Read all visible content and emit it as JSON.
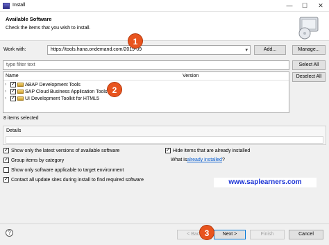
{
  "window": {
    "title": "Install",
    "minimize_glyph": "—",
    "maximize_glyph": "☐",
    "close_glyph": "✕"
  },
  "header": {
    "title": "Available Software",
    "subtitle": "Check the items that you wish to install."
  },
  "work_with": {
    "label": "Work with:",
    "value": "https://tools.hana.ondemand.com/2019-09",
    "add_label": "Add...",
    "manage_label": "Manage..."
  },
  "filter": {
    "placeholder": "type filter text",
    "select_all_label": "Select All",
    "deselect_all_label": "Deselect All"
  },
  "tree": {
    "columns": [
      "Name",
      "Version"
    ],
    "items": [
      {
        "label": "ABAP Development Tools",
        "checked": true
      },
      {
        "label": "SAP Cloud Business Application Tools",
        "checked": true
      },
      {
        "label": "UI Development Toolkit for HTML5",
        "checked": true
      }
    ]
  },
  "selected_count": "8 items selected",
  "details": {
    "label": "Details"
  },
  "options": {
    "latest_versions": "Show only the latest versions of available software",
    "group_by_category": "Group items by category",
    "target_env": "Show only software applicable to target environment",
    "contact_sites": "Contact all update sites during install to find required software",
    "hide_installed": "Hide items that are already installed",
    "what_is_prefix": "What is ",
    "what_is_link": "already installed",
    "what_is_suffix": "?"
  },
  "watermark": "www.saplearners.com",
  "footer": {
    "help_glyph": "?",
    "back_label": "< Back",
    "next_label": "Next >",
    "finish_label": "Finish",
    "cancel_label": "Cancel"
  },
  "badges": [
    "1",
    "2",
    "3"
  ],
  "colors": {
    "badge": "#e8541e",
    "watermark_text": "#1a33d6",
    "link": "#0b5fd0",
    "primary_border": "#0078d7"
  }
}
